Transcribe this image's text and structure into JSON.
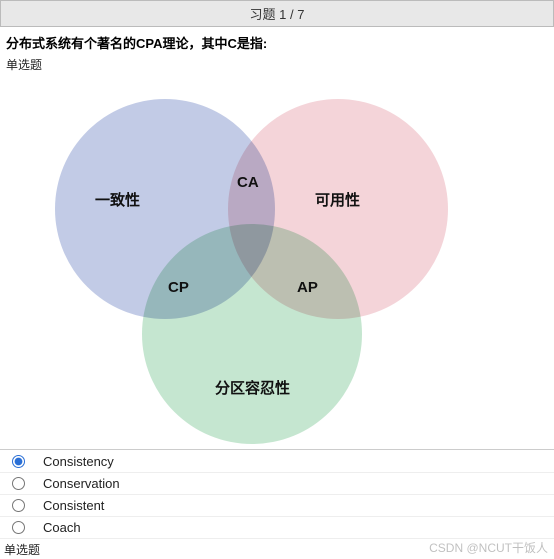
{
  "header": {
    "title": "习题 1 / 7"
  },
  "question": {
    "text": "分布式系统有个著名的CPA理论，其中C是指:",
    "type_label": "单选题"
  },
  "venn": {
    "left_label": "一致性",
    "right_label": "可用性",
    "bottom_label": "分区容忍性",
    "overlap_top": "CA",
    "overlap_left": "CP",
    "overlap_right": "AP"
  },
  "options": {
    "items": [
      {
        "label": "Consistency",
        "selected": true
      },
      {
        "label": "Conservation",
        "selected": false
      },
      {
        "label": "Consistent",
        "selected": false
      },
      {
        "label": "Coach",
        "selected": false
      }
    ]
  },
  "footer": {
    "type_label": "单选题"
  },
  "watermark": "CSDN @NCUT干饭人"
}
